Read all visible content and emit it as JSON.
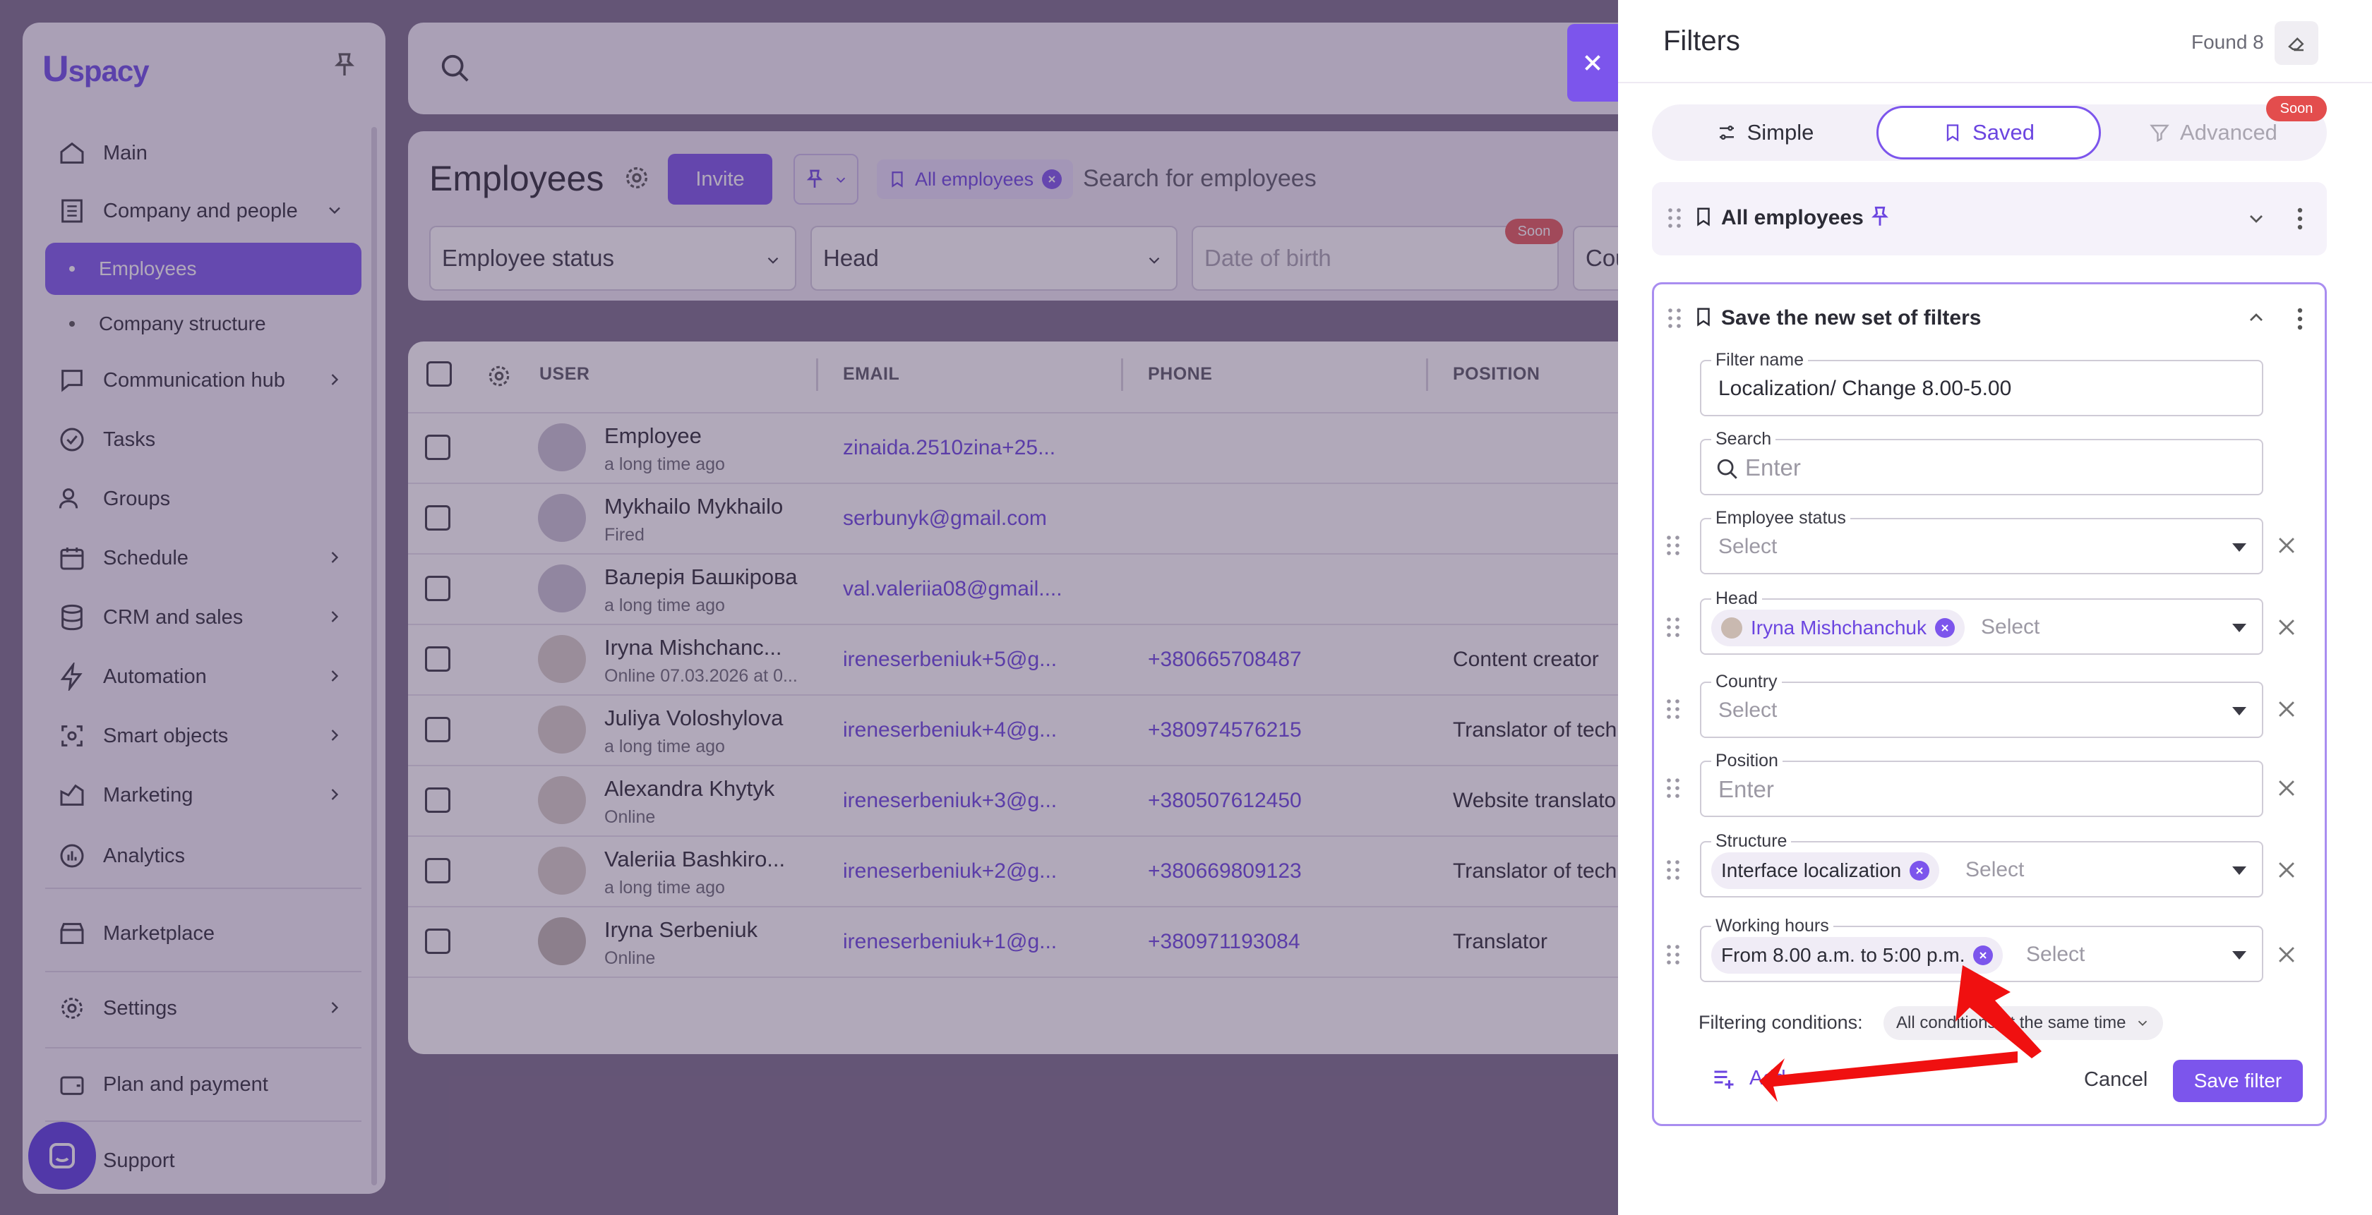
{
  "app": {
    "logo": "spacy",
    "logo_letter": "U"
  },
  "sidebar": {
    "items": [
      {
        "label": "Main",
        "icon": "home-icon"
      },
      {
        "label": "Company and people",
        "icon": "building-icon"
      },
      {
        "label": "Employees"
      },
      {
        "label": "Company structure"
      },
      {
        "label": "Communication hub",
        "icon": "chat-icon"
      },
      {
        "label": "Tasks",
        "icon": "check-circle-icon"
      },
      {
        "label": "Groups",
        "icon": "users-icon"
      },
      {
        "label": "Schedule",
        "icon": "calendar-icon"
      },
      {
        "label": "CRM and sales",
        "icon": "database-icon"
      },
      {
        "label": "Automation",
        "icon": "bolt-icon"
      },
      {
        "label": "Smart objects",
        "icon": "scan-icon"
      },
      {
        "label": "Marketing",
        "icon": "marketing-icon"
      },
      {
        "label": "Analytics",
        "icon": "chart-icon"
      },
      {
        "label": "Marketplace",
        "icon": "store-icon"
      },
      {
        "label": "Settings",
        "icon": "gear-icon"
      },
      {
        "label": "Plan and payment",
        "icon": "wallet-icon"
      },
      {
        "label": "Support",
        "icon": "support-icon"
      }
    ]
  },
  "employees_page": {
    "title": "Employees",
    "invite_label": "Invite",
    "chip_all_employees": "All employees",
    "search_placeholder": "Search for employees",
    "filters": {
      "employee_status": "Employee status",
      "head": "Head",
      "date_of_birth": "Date of birth",
      "country_partial": "Cou",
      "soon_badge": "Soon"
    },
    "table": {
      "headers": [
        "USER",
        "EMAIL",
        "PHONE",
        "POSITION"
      ],
      "rows": [
        {
          "name": "Employee",
          "sub": "a long time ago",
          "email": "zinaida.2510zina+25...",
          "phone": "",
          "position": ""
        },
        {
          "name": "Mykhailo Mykhailo",
          "sub": "Fired",
          "email": "serbunyk@gmail.com",
          "phone": "",
          "position": ""
        },
        {
          "name": "Валерія Башкірова",
          "sub": "a long time ago",
          "email": "val.valeriia08@gmail....",
          "phone": "",
          "position": ""
        },
        {
          "name": "Iryna Mishchanc...",
          "sub": "Online 07.03.2026 at 0...",
          "email": "ireneserbeniuk+5@g...",
          "phone": "+380665708487",
          "position": "Content creator"
        },
        {
          "name": "Juliya Voloshylova",
          "sub": "a long time ago",
          "email": "ireneserbeniuk+4@g...",
          "phone": "+380974576215",
          "position": "Translator of tech"
        },
        {
          "name": "Alexandra Khytyk",
          "sub": "Online",
          "email": "ireneserbeniuk+3@g...",
          "phone": "+380507612450",
          "position": "Website translato"
        },
        {
          "name": "Valeriia Bashkiro...",
          "sub": "a long time ago",
          "email": "ireneserbeniuk+2@g...",
          "phone": "+380669809123",
          "position": "Translator of tech"
        },
        {
          "name": "Iryna Serbeniuk",
          "sub": "Online",
          "email": "ireneserbeniuk+1@g...",
          "phone": "+380971193084",
          "position": "Translator"
        }
      ]
    }
  },
  "filters_panel": {
    "title": "Filters",
    "found": "Found 8",
    "tabs": {
      "simple": "Simple",
      "saved": "Saved",
      "advanced": "Advanced",
      "soon": "Soon"
    },
    "all_employees_card": {
      "title": "All employees"
    },
    "new_set": {
      "title": "Save the new set of filters",
      "filter_name_label": "Filter name",
      "filter_name_value": "Localization/ Change 8.00-5.00",
      "search_label": "Search",
      "search_placeholder": "Enter",
      "employee_status_label": "Employee status",
      "select_placeholder": "Select",
      "head_label": "Head",
      "head_tag": "Iryna Mishchanchuk",
      "country_label": "Country",
      "position_label": "Position",
      "position_placeholder": "Enter",
      "structure_label": "Structure",
      "structure_tag": "Interface localization",
      "working_hours_label": "Working hours",
      "working_hours_tag": "From 8.00 a.m. to 5:00 p.m.",
      "conditions_label": "Filtering conditions:",
      "conditions_value": "All conditions at the same time",
      "add_label": "Add",
      "cancel_label": "Cancel",
      "save_label": "Save filter"
    }
  },
  "colors": {
    "accent": "#7c55ec",
    "soon": "#e34d4d",
    "annotation_arrow": "#f01010"
  }
}
